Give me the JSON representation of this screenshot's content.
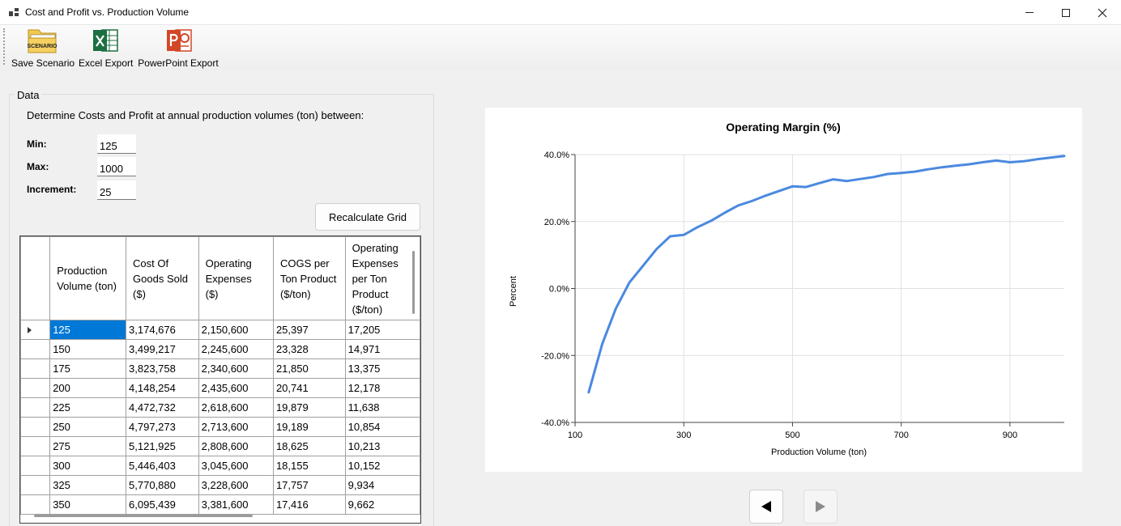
{
  "window": {
    "title": "Cost and Profit vs. Production Volume",
    "controls": [
      "minimize",
      "maximize",
      "close"
    ]
  },
  "toolbar": {
    "save_label": "Save Scenario",
    "save_icon_text": "SCENARIO",
    "excel_label": "Excel Export",
    "powerpoint_label": "PowerPoint Export"
  },
  "data_group": {
    "title": "Data",
    "description": "Determine Costs and Profit at annual production volumes (ton) between:",
    "min_label": "Min:",
    "min_value": "125",
    "max_label": "Max:",
    "max_value": "1000",
    "increment_label": "Increment:",
    "increment_value": "25",
    "recalc_label": "Recalculate Grid"
  },
  "grid": {
    "headers": [
      "Production Volume (ton)",
      "Cost Of Goods Sold ($)",
      "Operating Expenses ($)",
      "COGS per Ton Product ($/ton)",
      "Operating Expenses per Ton Product ($/ton)"
    ],
    "rows": [
      [
        "125",
        "3,174,676",
        "2,150,600",
        "25,397",
        "17,205"
      ],
      [
        "150",
        "3,499,217",
        "2,245,600",
        "23,328",
        "14,971"
      ],
      [
        "175",
        "3,823,758",
        "2,340,600",
        "21,850",
        "13,375"
      ],
      [
        "200",
        "4,148,254",
        "2,435,600",
        "20,741",
        "12,178"
      ],
      [
        "225",
        "4,472,732",
        "2,618,600",
        "19,879",
        "11,638"
      ],
      [
        "250",
        "4,797,273",
        "2,713,600",
        "19,189",
        "10,854"
      ],
      [
        "275",
        "5,121,925",
        "2,808,600",
        "18,625",
        "10,213"
      ],
      [
        "300",
        "5,446,403",
        "3,045,600",
        "18,155",
        "10,152"
      ],
      [
        "325",
        "5,770,880",
        "3,228,600",
        "17,757",
        "9,934"
      ],
      [
        "350",
        "6,095,439",
        "3,381,600",
        "17,416",
        "9,662"
      ]
    ]
  },
  "chart_data": {
    "type": "line",
    "title": "Operating Margin (%)",
    "xlabel": "Production Volume (ton)",
    "ylabel": "Percent",
    "xlim": [
      100,
      1000
    ],
    "ylim": [
      -40,
      40
    ],
    "xticks": [
      100,
      300,
      500,
      700,
      900
    ],
    "yticks": [
      40,
      20,
      0,
      -20,
      -40
    ],
    "ytick_labels": [
      "40.0%",
      "20.0%",
      "0.0%",
      "-20.0%",
      "-40.0%"
    ],
    "grid": true,
    "series": [
      {
        "color": "#4a89e0",
        "x": [
          125,
          150,
          175,
          200,
          225,
          250,
          275,
          300,
          325,
          350,
          375,
          400,
          425,
          450,
          475,
          500,
          525,
          550,
          575,
          600,
          625,
          650,
          675,
          700,
          725,
          750,
          775,
          800,
          825,
          850,
          875,
          900,
          925,
          950,
          975,
          1000
        ],
        "values": [
          -31.0,
          -16.5,
          -6.0,
          1.8,
          6.8,
          11.8,
          15.6,
          16.0,
          18.3,
          20.2,
          22.6,
          24.8,
          26.1,
          27.7,
          29.1,
          30.5,
          30.3,
          31.5,
          32.6,
          32.1,
          32.7,
          33.3,
          34.2,
          34.5,
          34.9,
          35.6,
          36.2,
          36.7,
          37.1,
          37.7,
          38.2,
          37.7,
          38.0,
          38.6,
          39.1,
          39.6
        ]
      }
    ]
  }
}
